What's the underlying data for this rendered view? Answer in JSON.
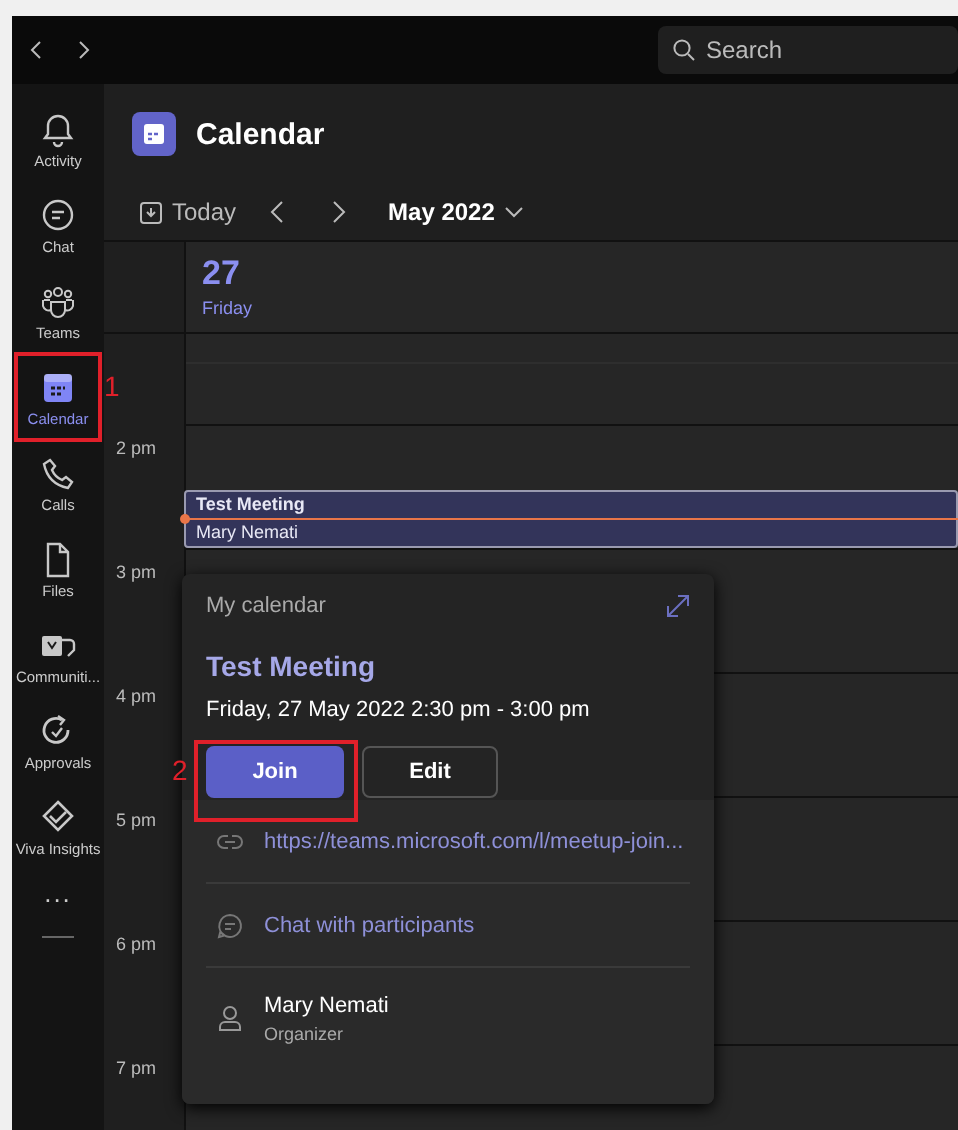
{
  "title_bar": {
    "search": {
      "placeholder": "Search"
    }
  },
  "rail": {
    "items": [
      {
        "label": "Activity",
        "selected": false
      },
      {
        "label": "Chat",
        "selected": false
      },
      {
        "label": "Teams",
        "selected": false
      },
      {
        "label": "Calendar",
        "selected": true,
        "annotation": "1"
      },
      {
        "label": "Calls",
        "selected": false
      },
      {
        "label": "Files",
        "selected": false
      },
      {
        "label": "Communiti...",
        "selected": false
      },
      {
        "label": "Approvals",
        "selected": false
      },
      {
        "label": "Viva Insights",
        "selected": false
      }
    ],
    "more": "..."
  },
  "header": {
    "title": "Calendar"
  },
  "toolbar": {
    "today": "Today",
    "month": "May 2022"
  },
  "day": {
    "number": "27",
    "weekday": "Friday"
  },
  "times": [
    "2 pm",
    "3 pm",
    "4 pm",
    "5 pm",
    "6 pm",
    "7 pm"
  ],
  "event": {
    "title": "Test Meeting",
    "organizer": "Mary Nemati"
  },
  "popup": {
    "calendar": "My calendar",
    "title": "Test Meeting",
    "when": "Friday, 27 May 2022 2:30 pm - 3:00 pm",
    "join": {
      "label": "Join",
      "annotation": "2"
    },
    "edit": "Edit",
    "link": "https://teams.microsoft.com/l/meetup-join...",
    "chat": "Chat with participants",
    "person": {
      "name": "Mary Nemati",
      "role": "Organizer"
    }
  }
}
